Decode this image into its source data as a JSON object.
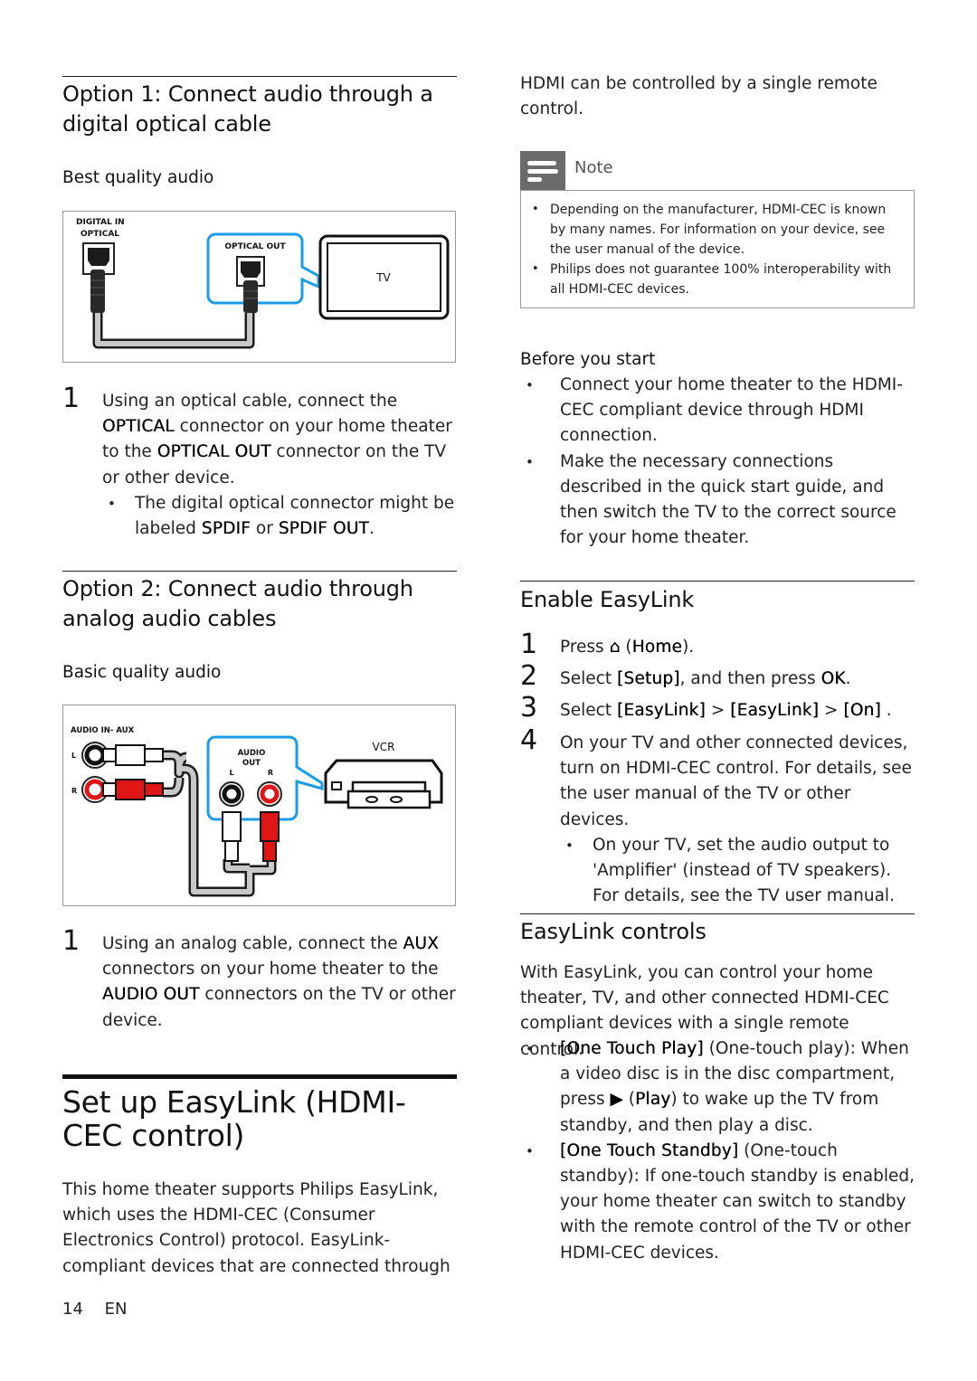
{
  "left": {
    "option1": {
      "heading": "Option 1: Connect audio through a digital optical cable",
      "subheading": "Best quality audio",
      "figure": {
        "home_theater_label_line1": "DIGITAL IN",
        "home_theater_label_line2": "OPTICAL",
        "device_port_label": "OPTICAL OUT",
        "device_label": "TV"
      },
      "step_number": "1",
      "step_parts": [
        "Using an optical cable, connect the ",
        "OPTICAL",
        " connector on your home theater to the ",
        "OPTICAL OUT",
        " connector on the TV or other device."
      ],
      "bullet_parts": [
        "The digital optical connector might be labeled ",
        "SPDIF",
        " or ",
        "SPDIF OUT",
        "."
      ]
    },
    "option2": {
      "heading": "Option 2: Connect audio through analog audio cables",
      "subheading": "Basic quality audio",
      "figure": {
        "home_theater_label": "AUDIO IN- AUX",
        "left_label": "L",
        "right_label": "R",
        "device_port_label_line1": "AUDIO",
        "device_port_label_line2": "OUT",
        "device_port_left": "L",
        "device_port_right": "R",
        "device_label": "VCR"
      },
      "step_number": "1",
      "step_parts": [
        "Using an analog cable, connect the ",
        "AUX",
        " connectors on your home theater to the ",
        "AUDIO OUT",
        " connectors on the TV or other device."
      ]
    },
    "setup": {
      "heading": "Set up EasyLink (HDMI-CEC control)",
      "intro": "This home theater supports Philips EasyLink, which uses the HDMI-CEC (Consumer Electronics Control) protocol. EasyLink-compliant devices that are connected through"
    }
  },
  "right": {
    "intro_cont": "HDMI can be controlled by a single remote control.",
    "note": {
      "label": "Note",
      "items": [
        "Depending on the manufacturer, HDMI-CEC is known by many names. For information on your device, see the user manual of the device.",
        "Philips does not guarantee 100% interoperability with all HDMI-CEC devices."
      ]
    },
    "before": {
      "heading": "Before you start",
      "items": [
        "Connect your home theater to the HDMI-CEC compliant device through HDMI connection.",
        "Make the necessary connections described in the quick start guide, and then switch the TV to the correct source for your home theater."
      ]
    },
    "enable": {
      "heading": "Enable EasyLink",
      "steps": [
        {
          "num": "1",
          "parts": [
            "Press ",
            "⌂",
            " (",
            "Home",
            ")."
          ]
        },
        {
          "num": "2",
          "parts": [
            "Select ",
            "[Setup]",
            ", and then press ",
            "OK",
            "."
          ]
        },
        {
          "num": "3",
          "parts": [
            "Select ",
            "[EasyLink]",
            " > ",
            "[EasyLink]",
            " > ",
            "[On]",
            " ."
          ]
        },
        {
          "num": "4",
          "text": "On your TV and other connected devices, turn on HDMI-CEC control. For details, see the user manual of the TV or other devices.",
          "bullet": "On your TV, set the audio output to 'Amplifier' (instead of TV speakers). For details, see the TV user manual."
        }
      ]
    },
    "controls": {
      "heading": "EasyLink controls",
      "intro": "With EasyLink, you can control your home theater, TV, and other connected HDMI-CEC compliant devices with a single remote control.",
      "items": [
        {
          "name": "[One Touch Play]",
          "parts": [
            " (One-touch play): When a video disc is in the disc compartment, press ",
            "▶",
            " (",
            "Play",
            ") to wake up the TV from standby, and then play a disc."
          ]
        },
        {
          "name": "[One Touch Standby]",
          "text": " (One-touch standby): If one-touch standby is enabled, your home theater can switch to standby with the remote control of the TV or other HDMI-CEC devices."
        }
      ]
    }
  },
  "footer": {
    "page_number": "14",
    "language": "EN"
  },
  "colors": {
    "highlight_blue": "#1a9ce6",
    "rca_red": "#e01515",
    "cable_gray": "#c8c8c8",
    "note_icon": "#6b6b6b"
  }
}
